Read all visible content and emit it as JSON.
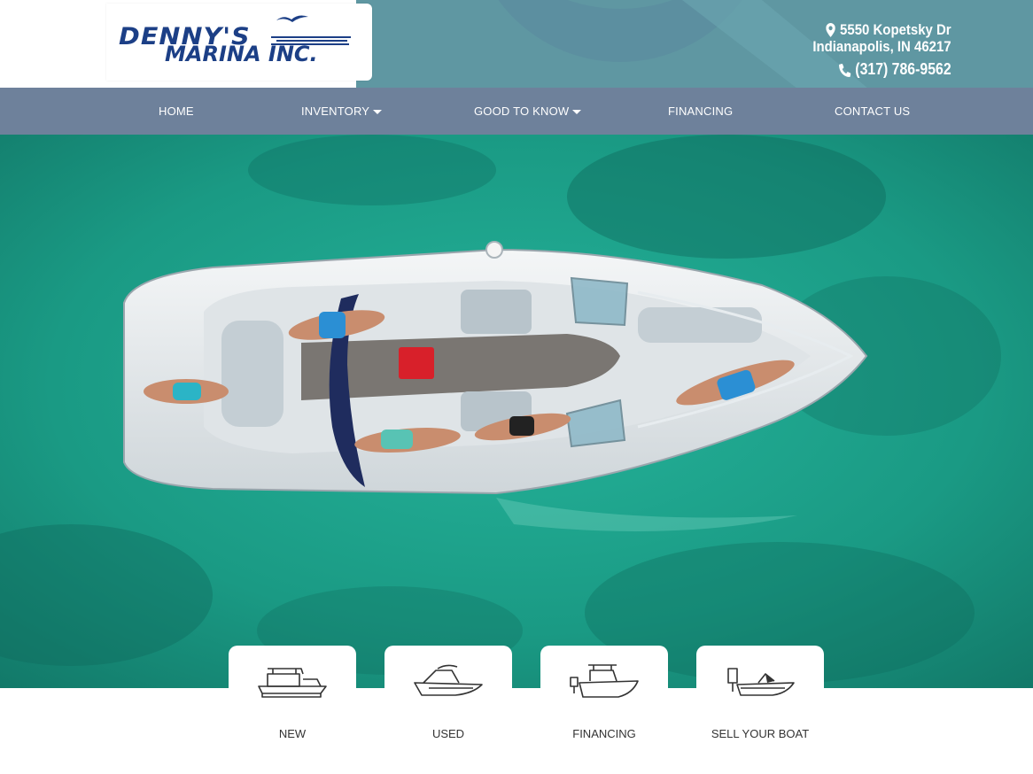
{
  "logo": {
    "line1": "DENNY'S",
    "line2": "MARINA INC.",
    "color": "#1c3f86"
  },
  "contact": {
    "address_line1": "5550 Kopetsky Dr",
    "address_line2": "Indianapolis, IN 46217",
    "phone": "(317) 786-9562",
    "icons": [
      "map-marker-icon",
      "phone-icon"
    ]
  },
  "nav": {
    "items": [
      {
        "label": "HOME",
        "dropdown": false
      },
      {
        "label": "INVENTORY",
        "dropdown": true
      },
      {
        "label": "GOOD TO KNOW",
        "dropdown": true
      },
      {
        "label": "FINANCING",
        "dropdown": false
      },
      {
        "label": "CONTACT US",
        "dropdown": false
      }
    ]
  },
  "hero": {
    "image": "aerial-boat-photo",
    "water_color": "#1c9b84"
  },
  "quick_links": [
    {
      "label": "NEW",
      "icon": "pontoon-boat-icon"
    },
    {
      "label": "USED",
      "icon": "bowrider-boat-icon"
    },
    {
      "label": "FINANCING",
      "icon": "fishing-boat-icon"
    },
    {
      "label": "SELL YOUR BOAT",
      "icon": "speed-boat-icon"
    }
  ],
  "colors": {
    "header_bg": "#5f97a2",
    "nav_bg": "#6e819b",
    "brand_blue": "#1c3f86"
  }
}
